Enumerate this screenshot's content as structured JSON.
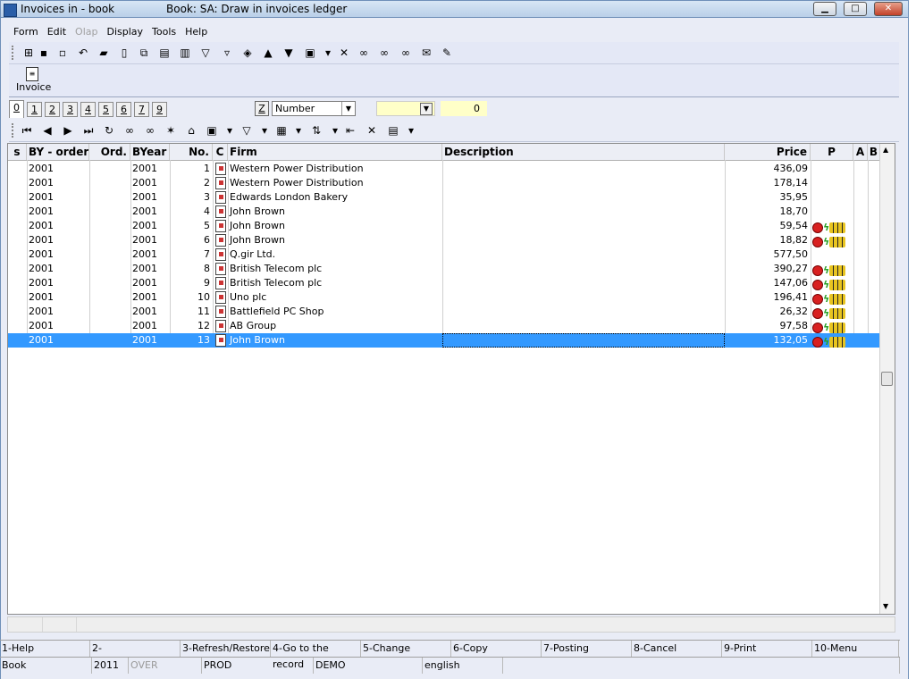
{
  "window": {
    "title": "Invoices in - book",
    "subtitle": "Book: SA: Draw in invoices ledger",
    "minimize": "▁",
    "maximize": "□",
    "close": "✕"
  },
  "menu": [
    {
      "label": "Form",
      "enabled": true
    },
    {
      "label": "Edit",
      "enabled": true
    },
    {
      "label": "Olap",
      "enabled": false
    },
    {
      "label": "Display",
      "enabled": true
    },
    {
      "label": "Tools",
      "enabled": true
    },
    {
      "label": "Help",
      "enabled": true
    }
  ],
  "main_toolbar": [
    {
      "icon": "tree-icon",
      "glyph": "⊞"
    },
    {
      "icon": "save-icon",
      "glyph": "▪"
    },
    {
      "icon": "save-as-icon",
      "glyph": "▫"
    },
    {
      "icon": "undo-icon",
      "glyph": "↶"
    },
    {
      "icon": "open-folder-icon",
      "glyph": "▰"
    },
    {
      "icon": "new-document-icon",
      "glyph": "▯"
    },
    {
      "icon": "copy-document-icon",
      "glyph": "⧉"
    },
    {
      "icon": "paste-document-icon",
      "glyph": "▤"
    },
    {
      "icon": "book-icon",
      "glyph": "▥"
    },
    {
      "icon": "filter-icon",
      "glyph": "▽"
    },
    {
      "icon": "filter-edit-icon",
      "glyph": "▿"
    },
    {
      "icon": "layers-icon",
      "glyph": "◈"
    },
    {
      "icon": "arrow-up-icon",
      "glyph": "▲"
    },
    {
      "icon": "arrow-down-icon",
      "glyph": "▼"
    },
    {
      "icon": "camera-icon",
      "glyph": "▣"
    },
    {
      "icon": "dropdown-arrow-icon",
      "glyph": "▾"
    },
    {
      "icon": "export-excel-icon",
      "glyph": "✕"
    },
    {
      "icon": "binoculars-icon",
      "glyph": "∞"
    },
    {
      "icon": "binoculars-next-icon",
      "glyph": "∞"
    },
    {
      "icon": "binoculars-prev-icon",
      "glyph": "∞"
    },
    {
      "icon": "mail-icon",
      "glyph": "✉"
    },
    {
      "icon": "sign-icon",
      "glyph": "✎"
    }
  ],
  "invoice_button": {
    "label": "Invoice"
  },
  "tabs": [
    "0",
    "1",
    "2",
    "3",
    "4",
    "5",
    "6",
    "7",
    "9"
  ],
  "active_tab": "0",
  "sort": {
    "z_label": "Z",
    "field": "Number",
    "count": "0"
  },
  "nav_toolbar": [
    {
      "icon": "first-record-icon",
      "glyph": "⏮"
    },
    {
      "icon": "prev-record-icon",
      "glyph": "◀"
    },
    {
      "icon": "next-record-icon",
      "glyph": "▶"
    },
    {
      "icon": "last-record-icon",
      "glyph": "⏭"
    },
    {
      "icon": "refresh-icon",
      "glyph": "↻"
    },
    {
      "icon": "find-icon",
      "glyph": "∞"
    },
    {
      "icon": "find-disabled-icon",
      "glyph": "∞"
    },
    {
      "icon": "star-folder-icon",
      "glyph": "✶"
    },
    {
      "icon": "folder-up-icon",
      "glyph": "⌂"
    },
    {
      "icon": "camera-icon",
      "glyph": "▣"
    },
    {
      "icon": "dropdown-arrow-icon",
      "glyph": "▾"
    },
    {
      "icon": "filter-icon",
      "glyph": "▽"
    },
    {
      "icon": "dropdown-arrow-icon",
      "glyph": "▾"
    },
    {
      "icon": "columns-icon",
      "glyph": "▦"
    },
    {
      "icon": "dropdown-arrow-icon",
      "glyph": "▾"
    },
    {
      "icon": "sort-az-icon",
      "glyph": "⇅"
    },
    {
      "icon": "dropdown-arrow-icon",
      "glyph": "▾"
    },
    {
      "icon": "indent-icon",
      "glyph": "⇤"
    },
    {
      "icon": "excel-icon",
      "glyph": "✕"
    },
    {
      "icon": "notes-icon",
      "glyph": "▤"
    },
    {
      "icon": "dropdown-arrow-icon",
      "glyph": "▾"
    }
  ],
  "columns": [
    "s",
    "BY - order",
    "Ord.",
    "BYear",
    "No.",
    "C",
    "Firm",
    "Description",
    "Price",
    "P",
    "A",
    "B"
  ],
  "rows": [
    {
      "by": "2001",
      "ord": "",
      "byear": "2001",
      "no": "1",
      "firm": "Western Power Distribution",
      "desc": "",
      "price": "436,09",
      "p": false,
      "selected": false
    },
    {
      "by": "2001",
      "ord": "",
      "byear": "2001",
      "no": "2",
      "firm": "Western Power Distribution",
      "desc": "",
      "price": "178,14",
      "p": false,
      "selected": false
    },
    {
      "by": "2001",
      "ord": "",
      "byear": "2001",
      "no": "3",
      "firm": "Edwards London Bakery",
      "desc": "",
      "price": "35,95",
      "p": false,
      "selected": false
    },
    {
      "by": "2001",
      "ord": "",
      "byear": "2001",
      "no": "4",
      "firm": "John Brown",
      "desc": "",
      "price": "18,70",
      "p": false,
      "selected": false
    },
    {
      "by": "2001",
      "ord": "",
      "byear": "2001",
      "no": "5",
      "firm": "John Brown",
      "desc": "",
      "price": "59,54",
      "p": true,
      "selected": false
    },
    {
      "by": "2001",
      "ord": "",
      "byear": "2001",
      "no": "6",
      "firm": "John Brown",
      "desc": "",
      "price": "18,82",
      "p": true,
      "selected": false
    },
    {
      "by": "2001",
      "ord": "",
      "byear": "2001",
      "no": "7",
      "firm": "Q.gir Ltd.",
      "desc": "",
      "price": "577,50",
      "p": false,
      "selected": false
    },
    {
      "by": "2001",
      "ord": "",
      "byear": "2001",
      "no": "8",
      "firm": "British Telecom plc",
      "desc": "",
      "price": "390,27",
      "p": true,
      "selected": false
    },
    {
      "by": "2001",
      "ord": "",
      "byear": "2001",
      "no": "9",
      "firm": "British Telecom plc",
      "desc": "",
      "price": "147,06",
      "p": true,
      "selected": false
    },
    {
      "by": "2001",
      "ord": "",
      "byear": "2001",
      "no": "10",
      "firm": "Uno plc",
      "desc": "",
      "price": "196,41",
      "p": true,
      "selected": false
    },
    {
      "by": "2001",
      "ord": "",
      "byear": "2001",
      "no": "11",
      "firm": "Battlefield PC Shop",
      "desc": "",
      "price": "26,32",
      "p": true,
      "selected": false
    },
    {
      "by": "2001",
      "ord": "",
      "byear": "2001",
      "no": "12",
      "firm": "AB Group",
      "desc": "",
      "price": "97,58",
      "p": true,
      "selected": false
    },
    {
      "by": "2001",
      "ord": "",
      "byear": "2001",
      "no": "13",
      "firm": "John Brown",
      "desc": "",
      "price": "132,05",
      "p": true,
      "selected": true
    }
  ],
  "function_keys": [
    "1-Help",
    "2-",
    "3-Refresh/Restore",
    "4-Go to the record",
    "5-Change",
    "6-Copy",
    "7-Posting",
    "8-Cancel",
    "9-Print",
    "10-Menu"
  ],
  "status_bar": [
    {
      "text": "Book",
      "dim": false
    },
    {
      "text": "2011",
      "dim": false
    },
    {
      "text": "OVER",
      "dim": true
    },
    {
      "text": "PROD",
      "dim": false
    },
    {
      "text": "DEMO",
      "dim": false
    },
    {
      "text": "english",
      "dim": false
    },
    {
      "text": "",
      "dim": false
    }
  ],
  "colors": {
    "selection": "#3399ff",
    "filter_bg": "#ffffc8",
    "toolbar_bg": "#e4e8f6"
  }
}
